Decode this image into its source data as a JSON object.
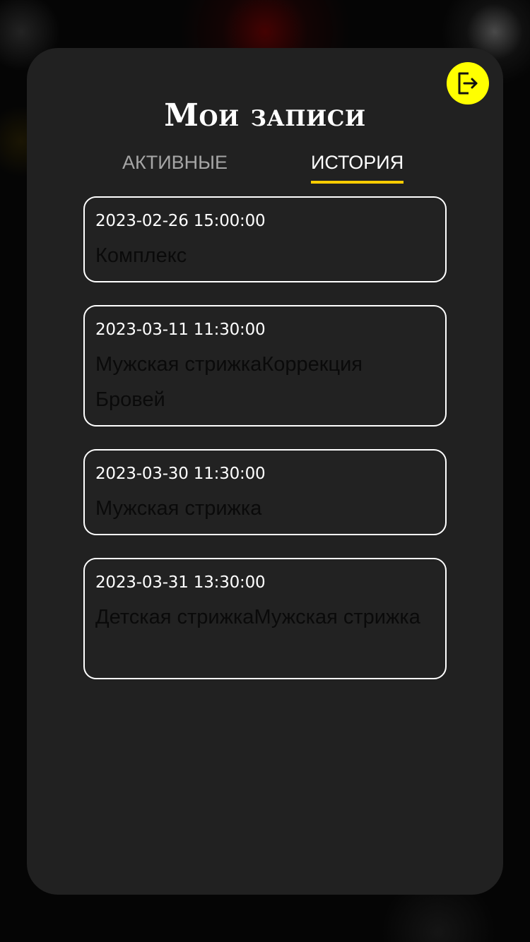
{
  "header": {
    "title": "Мои записи",
    "logout_icon": "logout-icon",
    "logout_color": "#ffff00"
  },
  "tabs": [
    {
      "label": "АКТИВНЫЕ",
      "selected": false
    },
    {
      "label": "ИСТОРИЯ",
      "selected": true
    }
  ],
  "history": [
    {
      "datetime": "2023-02-26 15:00:00",
      "service": "Комплекс"
    },
    {
      "datetime": "2023-03-11 11:30:00",
      "service": "Мужская стрижкаКоррекция Бровей"
    },
    {
      "datetime": "2023-03-30 11:30:00",
      "service": "Мужская стрижка"
    },
    {
      "datetime": "2023-03-31 13:30:00",
      "service": "Детская стрижкаМужская стрижка"
    }
  ],
  "colors": {
    "accent_yellow": "#ffff00",
    "tab_underline": "#ffcc00",
    "panel_background": "#212121"
  }
}
